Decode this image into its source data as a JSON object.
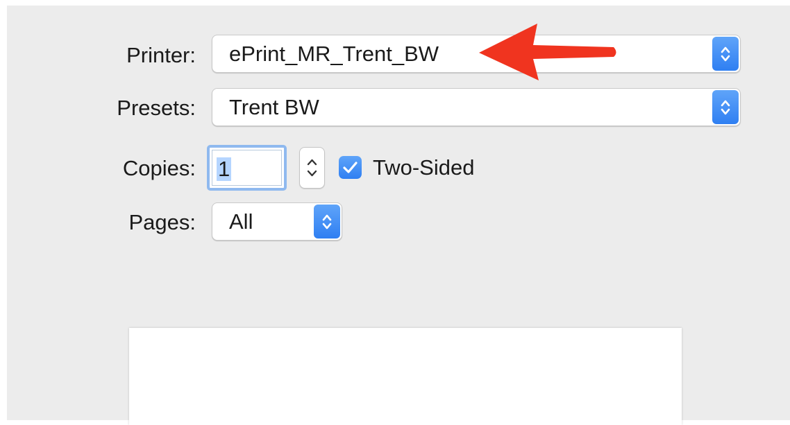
{
  "printer": {
    "label": "Printer:",
    "value": "ePrint_MR_Trent_BW"
  },
  "presets": {
    "label": "Presets:",
    "value": "Trent BW"
  },
  "copies": {
    "label": "Copies:",
    "value": "1"
  },
  "two_sided": {
    "label": "Two-Sided",
    "checked": true
  },
  "pages": {
    "label": "Pages:",
    "value": "All"
  },
  "icons": {
    "popup_arrows": "up-down-chevron-icon",
    "checkmark": "checkmark-icon",
    "annotation": "red-arrow-icon"
  },
  "colors": {
    "accent": "#2f7ff2",
    "annotation": "#f0341f",
    "background": "#ececec"
  }
}
